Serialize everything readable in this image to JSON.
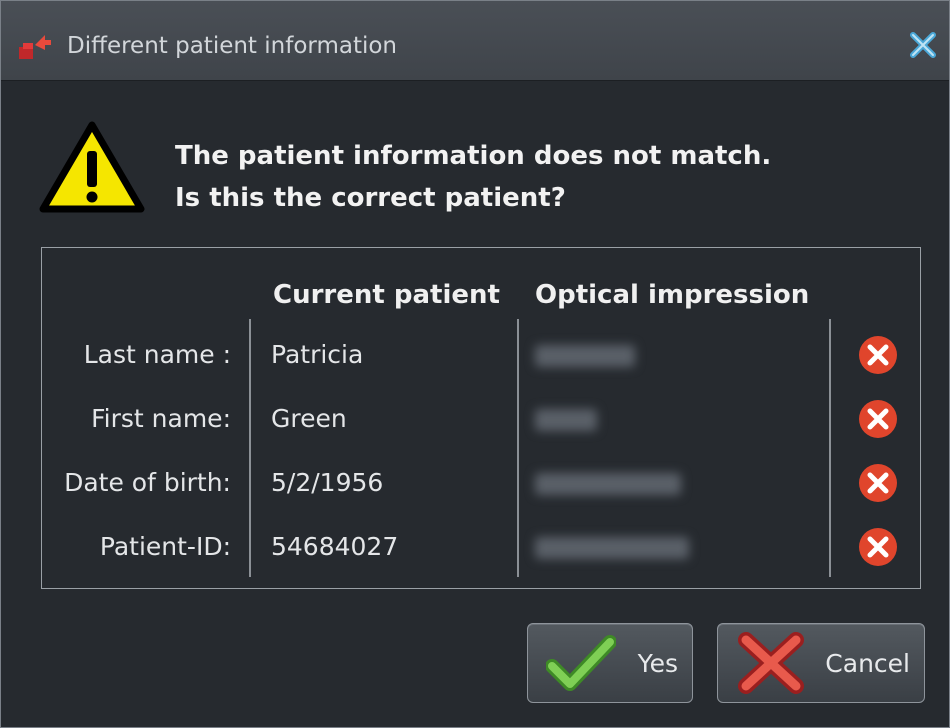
{
  "window": {
    "title": "Different patient information"
  },
  "message": {
    "line1": "The patient information does not match.",
    "line2": "Is this the correct patient?"
  },
  "table": {
    "headers": {
      "current": "Current patient",
      "optical": "Optical impression"
    },
    "rows": [
      {
        "label": "Last name :",
        "current": "Patricia"
      },
      {
        "label": "First name:",
        "current": "Green"
      },
      {
        "label": "Date of birth:",
        "current": "5/2/1956"
      },
      {
        "label": "Patient-ID:",
        "current": "54684027"
      }
    ]
  },
  "buttons": {
    "yes": "Yes",
    "cancel": "Cancel"
  },
  "colors": {
    "warning_fill": "#f5e600",
    "remove_red": "#e0452c",
    "accept_green": "#5cb43c",
    "cancel_red": "#d23b3b"
  }
}
